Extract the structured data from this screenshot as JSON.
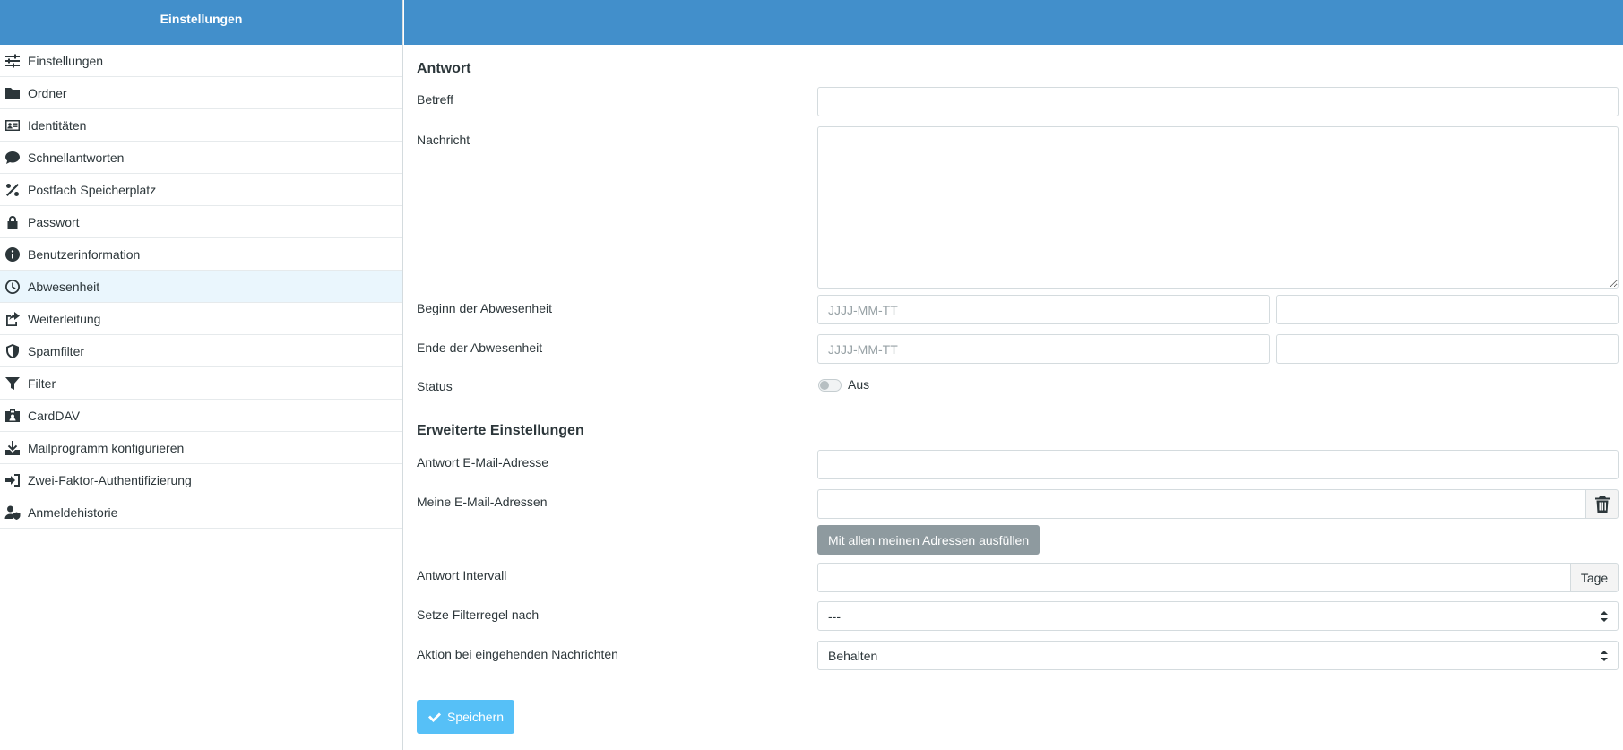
{
  "sidebar": {
    "header": "Einstellungen",
    "items": [
      {
        "label": "Einstellungen",
        "icon": "sliders-icon"
      },
      {
        "label": "Ordner",
        "icon": "folder-icon"
      },
      {
        "label": "Identitäten",
        "icon": "id-card-icon"
      },
      {
        "label": "Schnellantworten",
        "icon": "comment-icon"
      },
      {
        "label": "Postfach Speicherplatz",
        "icon": "percent-icon"
      },
      {
        "label": "Passwort",
        "icon": "lock-icon"
      },
      {
        "label": "Benutzerinformation",
        "icon": "info-icon"
      },
      {
        "label": "Abwesenheit",
        "icon": "clock-icon",
        "selected": true
      },
      {
        "label": "Weiterleitung",
        "icon": "share-icon"
      },
      {
        "label": "Spamfilter",
        "icon": "shield-icon"
      },
      {
        "label": "Filter",
        "icon": "filter-icon"
      },
      {
        "label": "CardDAV",
        "icon": "contact-badge-icon"
      },
      {
        "label": "Mailprogramm konfigurieren",
        "icon": "download-icon"
      },
      {
        "label": "Zwei-Faktor-Authentifizierung",
        "icon": "sign-in-icon"
      },
      {
        "label": "Anmeldehistorie",
        "icon": "user-shield-icon"
      }
    ]
  },
  "form": {
    "section_reply": "Antwort",
    "subject_label": "Betreff",
    "subject_value": "",
    "message_label": "Nachricht",
    "message_value": "",
    "start_label": "Beginn der Abwesenheit",
    "start_date_placeholder": "JJJJ-MM-TT",
    "start_time_value": "",
    "end_label": "Ende der Abwesenheit",
    "end_date_placeholder": "JJJJ-MM-TT",
    "end_time_value": "",
    "status_label": "Status",
    "status_value": "Aus",
    "section_advanced": "Erweiterte Einstellungen",
    "reply_email_label": "Antwort E-Mail-Adresse",
    "reply_email_value": "",
    "my_emails_label": "Meine E-Mail-Adressen",
    "my_emails_value": "",
    "fill_all_button": "Mit allen meinen Adressen ausfüllen",
    "interval_label": "Antwort Intervall",
    "interval_value": "",
    "interval_unit": "Tage",
    "filter_rule_label": "Setze Filterregel nach",
    "filter_rule_value": "---",
    "action_label": "Aktion bei eingehenden Nachrichten",
    "action_value": "Behalten",
    "save_button": "Speichern"
  },
  "colors": {
    "header_blue": "#428fcb",
    "selected_row": "#eaf6fd",
    "save_button": "#56c0f7",
    "grey_button": "#8e9a9f"
  }
}
